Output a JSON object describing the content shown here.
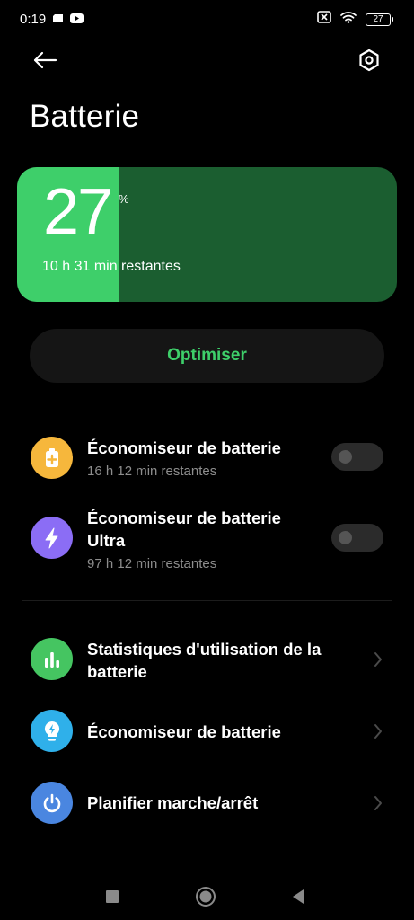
{
  "status_bar": {
    "time": "0:19",
    "battery_level": "27",
    "icons": [
      "sim-card-icon",
      "youtube-icon",
      "no-sim-icon",
      "wifi-icon",
      "battery-icon"
    ]
  },
  "header": {
    "title": "Batterie",
    "back_icon": "arrow-left-icon",
    "settings_icon": "hexagon-settings-icon"
  },
  "battery_card": {
    "percent": "27",
    "unit": "%",
    "remaining": "10 h 31 min restantes",
    "level_fraction": 0.27,
    "fill_color": "#3ecf6a",
    "bg_color": "#1b5e30"
  },
  "optimize": {
    "label": "Optimiser",
    "color": "#3ecf6a"
  },
  "savers": [
    {
      "title": "Économiseur de batterie",
      "subtitle": "16 h 12 min restantes",
      "icon": "battery-plus-icon",
      "icon_color": "#f6b73c",
      "enabled": false
    },
    {
      "title": "Économiseur de batterie Ultra",
      "subtitle": "97 h 12 min restantes",
      "icon": "lightning-bolt-icon",
      "icon_color": "#8b6df5",
      "enabled": false
    }
  ],
  "links": [
    {
      "title": "Statistiques d'utilisation de la batterie",
      "icon": "bar-chart-icon",
      "icon_color": "#45c561"
    },
    {
      "title": "Économiseur de batterie",
      "icon": "bulb-bolt-icon",
      "icon_color": "#2fb0ea"
    },
    {
      "title": "Planifier marche/arrêt",
      "icon": "power-icon",
      "icon_color": "#4a86e0"
    }
  ],
  "nav_bar": {
    "icons": [
      "recents-square-icon",
      "home-circle-icon",
      "back-triangle-icon"
    ]
  }
}
